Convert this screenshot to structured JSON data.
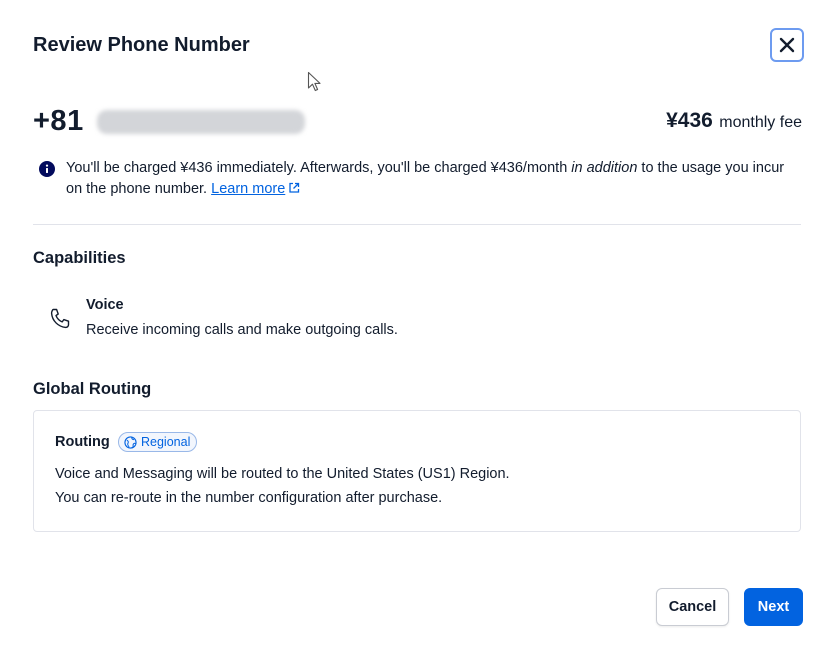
{
  "modal": {
    "title": "Review Phone Number",
    "close_label": "Close"
  },
  "number": {
    "country_code": "+81",
    "fee_amount": "¥436",
    "fee_suffix": "monthly fee"
  },
  "notice": {
    "text_before": "You'll be charged ¥436 immediately. Afterwards, you'll be charged ¥436/month ",
    "emphasis": "in addition",
    "text_after": " to the usage you incur on the phone number. ",
    "link_label": "Learn more"
  },
  "capabilities": {
    "heading": "Capabilities",
    "items": [
      {
        "name": "Voice",
        "description": "Receive incoming calls and make outgoing calls.",
        "icon": "phone-icon"
      }
    ]
  },
  "global_routing": {
    "heading": "Global Routing",
    "label": "Routing",
    "badge": "Regional",
    "line1": "Voice and Messaging will be routed to the United States (US1) Region.",
    "line2": "You can re-route in the number configuration after purchase."
  },
  "footer": {
    "cancel_label": "Cancel",
    "next_label": "Next"
  },
  "colors": {
    "primary": "#0263e0",
    "text": "#121c2d",
    "border": "#e1e3ea",
    "info_icon": "#030b5d"
  }
}
